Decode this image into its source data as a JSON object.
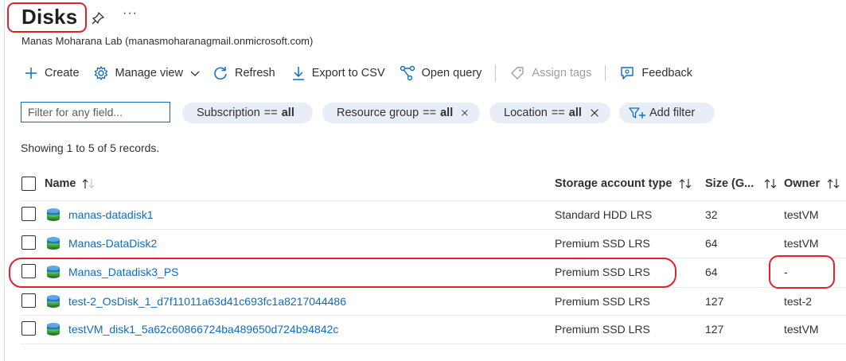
{
  "page": {
    "title": "Disks",
    "subtitle": "Manas Moharana Lab (manasmoharanagmail.onmicrosoft.com)",
    "more_label": "···"
  },
  "toolbar": {
    "create": "Create",
    "manage_view": "Manage view",
    "refresh": "Refresh",
    "export_csv": "Export to CSV",
    "open_query": "Open query",
    "assign_tags": "Assign tags",
    "feedback": "Feedback"
  },
  "filters": {
    "placeholder": "Filter for any field...",
    "subscription": {
      "label": "Subscription",
      "op": "==",
      "value": "all"
    },
    "resource_group": {
      "label": "Resource group",
      "op": "==",
      "value": "all"
    },
    "location": {
      "label": "Location",
      "op": "==",
      "value": "all"
    },
    "add_filter": "Add filter"
  },
  "records_text": "Showing 1 to 5 of 5 records.",
  "table": {
    "columns": {
      "name": "Name",
      "storage": "Storage account type",
      "size": "Size (G...",
      "owner": "Owner"
    },
    "rows": [
      {
        "name": "manas-datadisk1",
        "storage": "Standard HDD LRS",
        "size": "32",
        "owner": "testVM"
      },
      {
        "name": "Manas-DataDisk2",
        "storage": "Premium SSD LRS",
        "size": "64",
        "owner": "testVM"
      },
      {
        "name": "Manas_Datadisk3_PS",
        "storage": "Premium SSD LRS",
        "size": "64",
        "owner": "-"
      },
      {
        "name": "test-2_OsDisk_1_d7f11011a63d41c693fc1a8217044486",
        "storage": "Premium SSD LRS",
        "size": "127",
        "owner": "test-2"
      },
      {
        "name": "testVM_disk1_5a62c60866724ba489650d724b94842c",
        "storage": "Premium SSD LRS",
        "size": "127",
        "owner": "testVM"
      }
    ]
  },
  "colors": {
    "accent": "#0f6cbd",
    "highlight": "#e0222a",
    "pill_bg": "#e8eef8"
  }
}
